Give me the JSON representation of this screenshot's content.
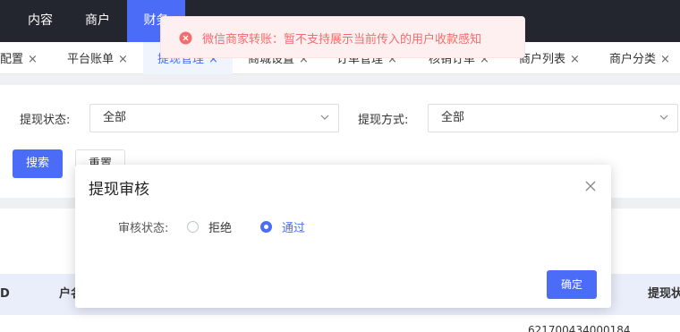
{
  "topnav": {
    "items": [
      "内容",
      "商户",
      "财务"
    ]
  },
  "tabs": [
    {
      "label": "配置"
    },
    {
      "label": "平台账单"
    },
    {
      "label": "提现管理"
    },
    {
      "label": "商城设置"
    },
    {
      "label": "订单管理"
    },
    {
      "label": "核销订单"
    },
    {
      "label": "商户列表"
    },
    {
      "label": "商户分类"
    }
  ],
  "tab_close_glyph": "×",
  "filters": {
    "status_label": "提现状态:",
    "status_value": "全部",
    "method_label": "提现方式:",
    "method_value": "全部",
    "search_button": "搜索",
    "reset_button": "重置"
  },
  "table": {
    "headers": [
      "D",
      "户名",
      "提现状"
    ],
    "peek_value": "621700434000184"
  },
  "dialog": {
    "title": "提现审核",
    "status_label": "审核状态:",
    "options": [
      {
        "label": "拒绝",
        "selected": false
      },
      {
        "label": "通过",
        "selected": true
      }
    ],
    "confirm_button": "确定"
  },
  "toast": {
    "type": "error",
    "message": "微信商家转账：暂不支持展示当前传入的用户收款感知"
  },
  "colors": {
    "accent": "#4a6cf7",
    "nav_bg": "#23262e",
    "error": "#f56c6c"
  }
}
